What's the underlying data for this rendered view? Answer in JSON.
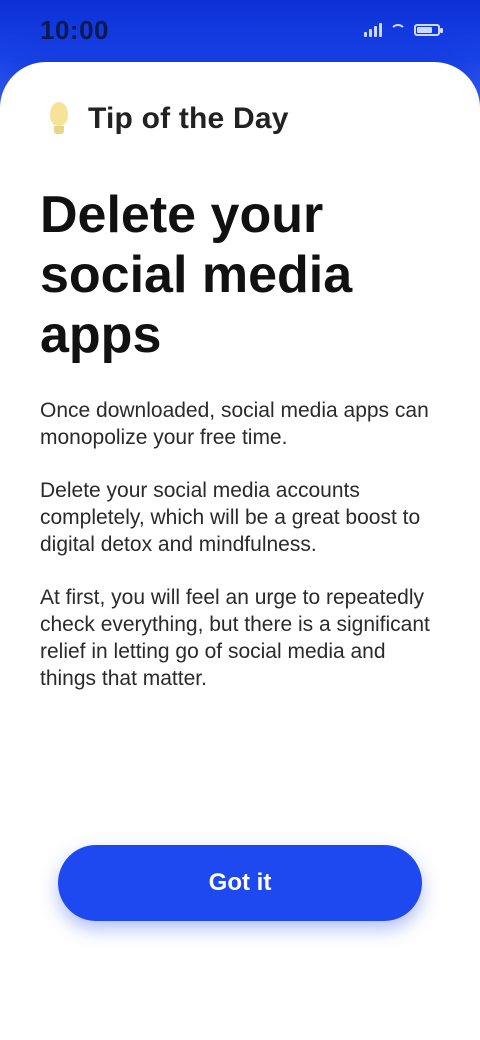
{
  "status_bar": {
    "time": "10:00"
  },
  "header": {
    "icon": "lightbulb-icon",
    "title": "Tip of the Day"
  },
  "tip": {
    "title": "Delete your social media apps",
    "paragraphs": [
      "Once downloaded, social media apps can monopolize your free time.",
      "Delete your social media accounts completely, which will be a great boost to digital detox and mindfulness.",
      "At first, you will feel an urge to repeatedly check everything, but there is a significant relief in letting go of social media and things that matter."
    ]
  },
  "actions": {
    "primary_label": "Got it"
  },
  "colors": {
    "accent": "#1f49f0",
    "header_gradient_top": "#0a2fd6",
    "bulb": "#f6e39a"
  }
}
